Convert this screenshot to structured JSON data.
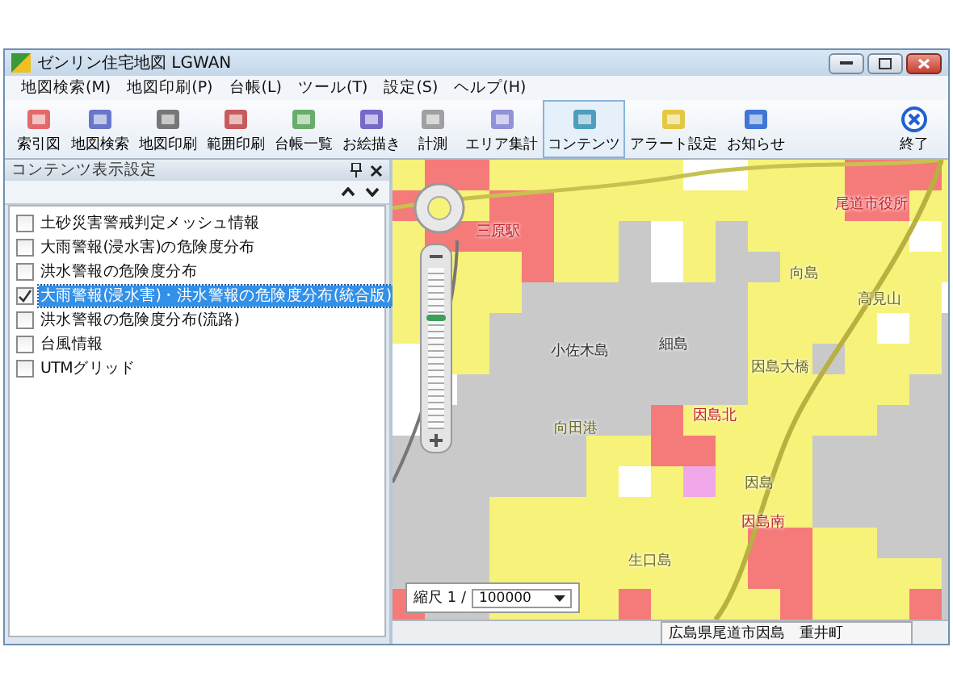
{
  "window": {
    "title": "ゼンリン住宅地図 LGWAN"
  },
  "menu": [
    "地図検索(M)",
    "地図印刷(P)",
    "台帳(L)",
    "ツール(T)",
    "設定(S)",
    "ヘルプ(H)"
  ],
  "toolbar": [
    {
      "label": "索引図",
      "selected": false
    },
    {
      "label": "地図検索",
      "selected": false
    },
    {
      "label": "地図印刷",
      "selected": false
    },
    {
      "label": "範囲印刷",
      "selected": false
    },
    {
      "label": "台帳一覧",
      "selected": false
    },
    {
      "label": "お絵描き",
      "selected": false
    },
    {
      "label": "計測",
      "selected": false
    },
    {
      "label": "エリア集計",
      "selected": false
    },
    {
      "label": "コンテンツ",
      "selected": true
    },
    {
      "label": "アラート設定",
      "selected": false
    },
    {
      "label": "お知らせ",
      "selected": false
    }
  ],
  "exit_button": {
    "label": "終了"
  },
  "panel": {
    "title": "コンテンツ表示設定",
    "items": [
      {
        "label": "土砂災害警戒判定メッシュ情報",
        "checked": false,
        "selected": false
      },
      {
        "label": "大雨警報(浸水害)の危険度分布",
        "checked": false,
        "selected": false
      },
      {
        "label": "洪水警報の危険度分布",
        "checked": false,
        "selected": false
      },
      {
        "label": "大雨警報(浸水害)・洪水警報の危険度分布(統合版)",
        "checked": true,
        "selected": true
      },
      {
        "label": "洪水警報の危険度分布(流路)",
        "checked": false,
        "selected": false
      },
      {
        "label": "台風情報",
        "checked": false,
        "selected": false
      },
      {
        "label": "UTMグリッド",
        "checked": false,
        "selected": false
      }
    ]
  },
  "map": {
    "labels": [
      {
        "text": "三原駅",
        "kind": "station"
      },
      {
        "text": "尾道市役所",
        "kind": "station"
      },
      {
        "text": "向島",
        "kind": "place"
      },
      {
        "text": "高見山",
        "kind": "place"
      },
      {
        "text": "小佐木島",
        "kind": "island"
      },
      {
        "text": "細島",
        "kind": "island"
      },
      {
        "text": "因島大橋",
        "kind": "place"
      },
      {
        "text": "因島北",
        "kind": "station"
      },
      {
        "text": "向田港",
        "kind": "place"
      },
      {
        "text": "因島",
        "kind": "place"
      },
      {
        "text": "因島南",
        "kind": "station"
      },
      {
        "text": "生口島",
        "kind": "place"
      }
    ],
    "zoom_slider": {
      "level": 0.67
    },
    "scale": {
      "label": "縮尺 1 /",
      "value": "100000"
    }
  },
  "status_bar": {
    "location": "広島県尾道市因島　重井町"
  }
}
